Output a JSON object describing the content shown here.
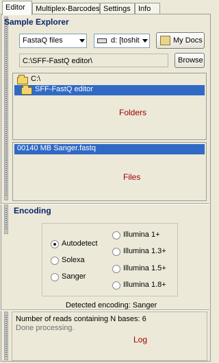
{
  "tabs": [
    "Editor",
    "Multiplex-Barcodes",
    "Settings",
    "Info"
  ],
  "explorer": {
    "title": "Sample Explorer",
    "filter_value": "FastaQ files",
    "drive_value": "d: [toshit",
    "my_docs_label": "My Docs",
    "path_value": "C:\\SFF-FastQ editor\\",
    "browse_label": "Browse",
    "folders": [
      "C:\\",
      "SFF-FastQ editor"
    ],
    "folders_label": "Folders",
    "files": [
      "00140 MB Sanger.fastq"
    ],
    "files_label": "Files"
  },
  "encoding": {
    "title": "Encoding",
    "options_left": [
      "Autodetect",
      "Solexa",
      "Sanger"
    ],
    "options_right": [
      "Illumina 1+",
      "Illumina 1.3+",
      "Illumina 1.5+",
      "Illumina 1.8+"
    ],
    "selected": "Autodetect",
    "detected_text": "Detected encoding: Sanger"
  },
  "log": {
    "line1": "Number of reads containing N bases: 6",
    "line2": "Done processing.",
    "label": "Log"
  }
}
